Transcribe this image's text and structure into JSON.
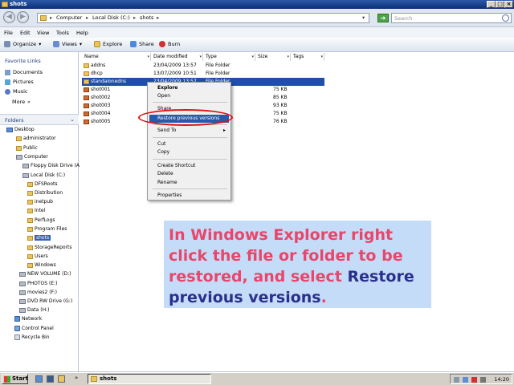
{
  "window": {
    "title": "shots"
  },
  "address": {
    "crumbs": [
      "Computer",
      "Local Disk (C:)",
      "shots"
    ],
    "search_placeholder": "Search"
  },
  "menubar": [
    "File",
    "Edit",
    "View",
    "Tools",
    "Help"
  ],
  "toolbar": {
    "organize": "Organize",
    "views": "Views",
    "explore": "Explore",
    "share": "Share",
    "burn": "Burn"
  },
  "nav": {
    "favorites_title": "Favorite Links",
    "favorites": [
      "Documents",
      "Pictures",
      "Music"
    ],
    "more": "More",
    "folders_title": "Folders",
    "tree": [
      "Desktop",
      "administrator",
      "Public",
      "Computer",
      "Floppy Disk Drive (A",
      "Local Disk (C:)",
      "DFSRoots",
      "Distribution",
      "inetpub",
      "Intel",
      "PerfLogs",
      "Program Files",
      "shots",
      "StorageReports",
      "Users",
      "Windows",
      "NEW VOLUME (D:)",
      "PHOTOS (E:)",
      "movies2 (F:)",
      "DVD RW Drive (G:)",
      "Data (H:)",
      "Network",
      "Control Panel",
      "Recycle Bin"
    ]
  },
  "columns": [
    "Name",
    "Date modified",
    "Type",
    "Size",
    "Tags"
  ],
  "files": [
    {
      "name": "addns",
      "date": "23/04/2009 13:57",
      "type": "File Folder",
      "size": ""
    },
    {
      "name": "dhcp",
      "date": "13/07/2009 10:51",
      "type": "File Folder",
      "size": ""
    },
    {
      "name": "standalonedns",
      "date": "23/04/2009 13:57",
      "type": "File Folder",
      "size": ""
    },
    {
      "name": "shot001",
      "date": "",
      "type": "",
      "size": "75 KB"
    },
    {
      "name": "shot002",
      "date": "",
      "type": "",
      "size": "85 KB"
    },
    {
      "name": "shot003",
      "date": "",
      "type": "",
      "size": "93 KB"
    },
    {
      "name": "shot004",
      "date": "",
      "type": "",
      "size": "75 KB"
    },
    {
      "name": "shot005",
      "date": "",
      "type": "",
      "size": "76 KB"
    }
  ],
  "context_menu": {
    "explore": "Explore",
    "open": "Open",
    "share": "Share...",
    "restore": "Restore previous versions",
    "send_to": "Send To",
    "cut": "Cut",
    "copy": "Copy",
    "create_shortcut": "Create Shortcut",
    "delete": "Delete",
    "rename": "Rename",
    "properties": "Properties"
  },
  "callout": {
    "part1": "In Windows Explorer right click the file or folder to be restored, and select ",
    "part2": "Restore previous versions",
    "part3": "."
  },
  "taskbar": {
    "start": "Start",
    "task": "shots",
    "clock": "14:20"
  }
}
